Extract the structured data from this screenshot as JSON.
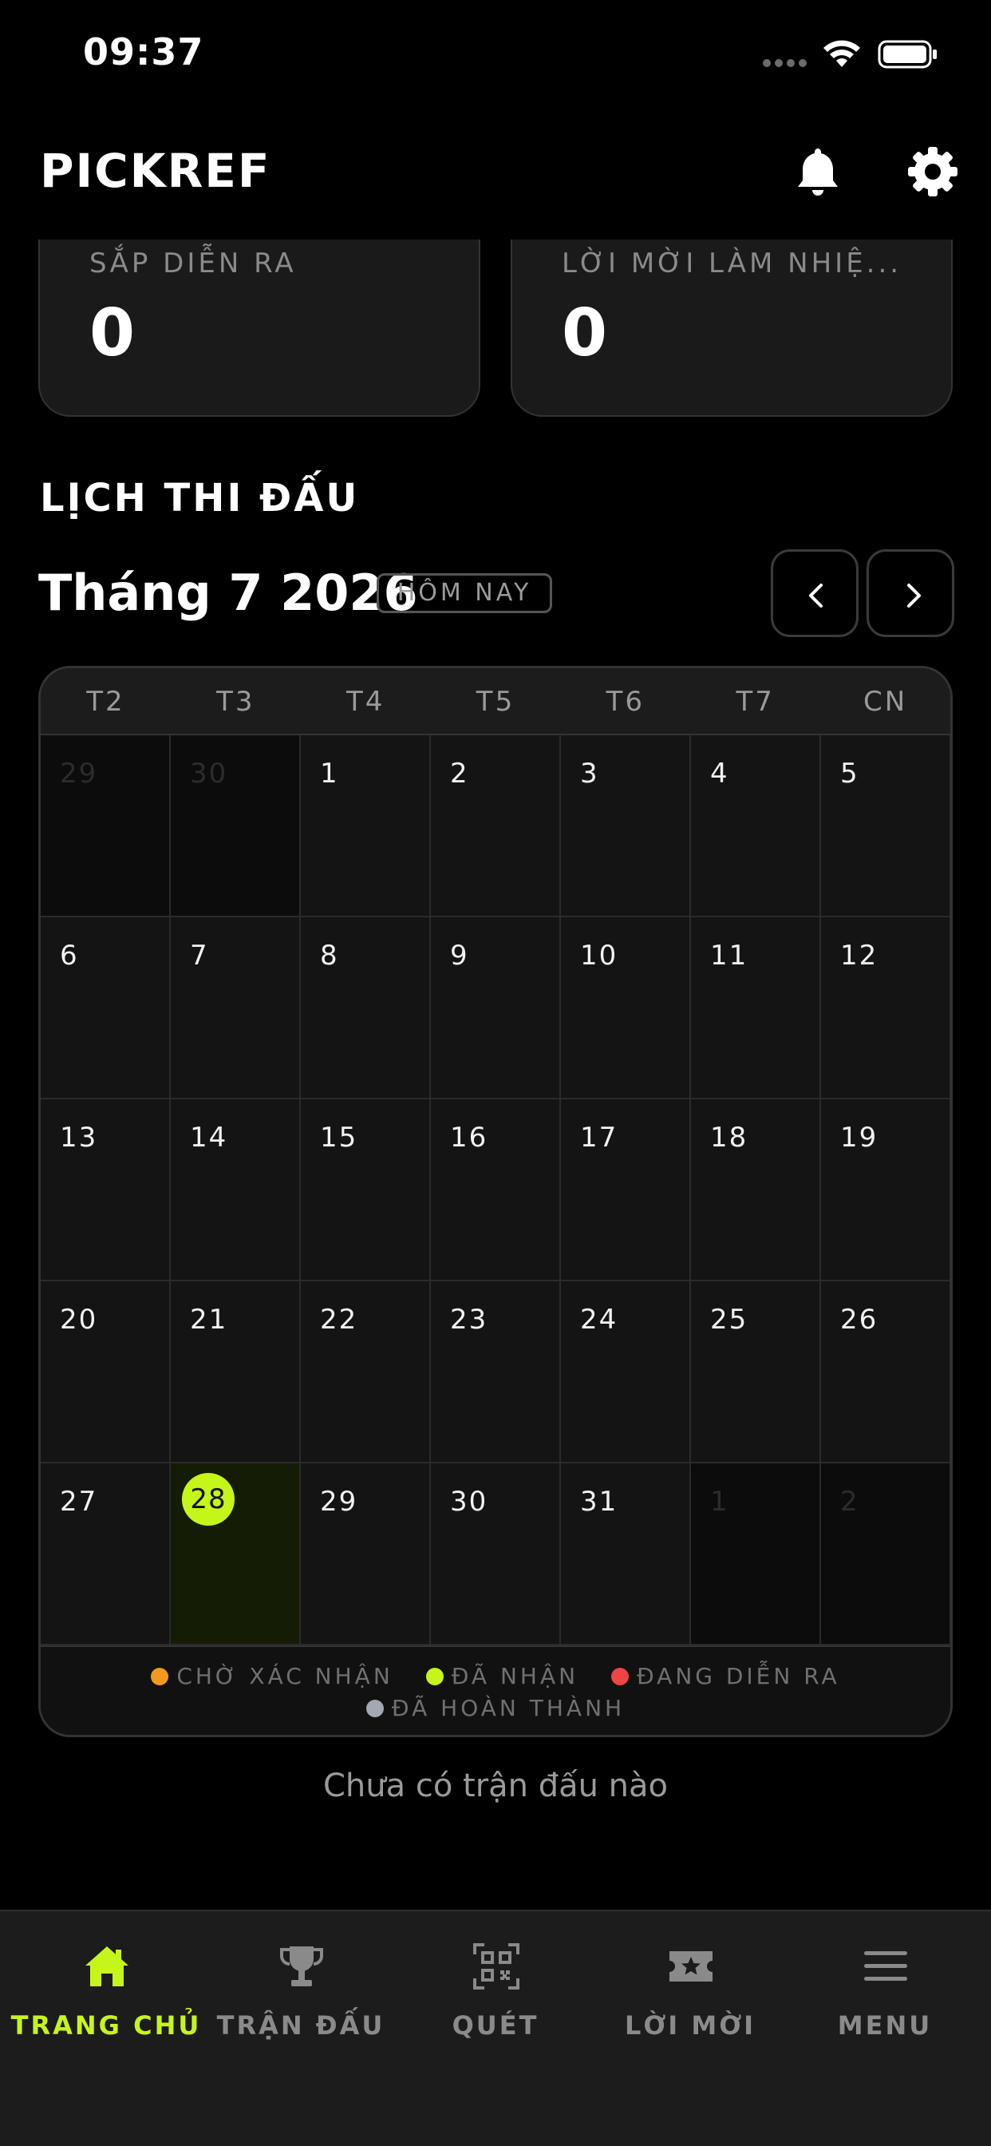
{
  "status_bar": {
    "time": "09:37"
  },
  "header": {
    "brand": "PICKREF"
  },
  "stats": [
    {
      "label": "SẮP DIỄN RA",
      "value": "0"
    },
    {
      "label": "LỜI MỜI LÀM NHIỆ...",
      "value": "0"
    }
  ],
  "schedule": {
    "section_title": "LỊCH THI ĐẤU",
    "month_title": "Tháng 7 2026",
    "today_label": "HÔM NAY",
    "weekdays": [
      "T2",
      "T3",
      "T4",
      "T5",
      "T6",
      "T7",
      "CN"
    ],
    "days": [
      "29",
      "30",
      "1",
      "2",
      "3",
      "4",
      "5",
      "6",
      "7",
      "8",
      "9",
      "10",
      "11",
      "12",
      "13",
      "14",
      "15",
      "16",
      "17",
      "18",
      "19",
      "20",
      "21",
      "22",
      "23",
      "24",
      "25",
      "26",
      "27",
      "28",
      "29",
      "30",
      "31",
      "1",
      "2"
    ],
    "outside_month_indices": [
      0,
      1,
      33,
      34
    ],
    "today_index": 29,
    "legend": [
      {
        "label": "CHỜ XÁC NHẬN",
        "color": "#f39a1c"
      },
      {
        "label": "ĐÃ NHẬN",
        "color": "#c6f51a"
      },
      {
        "label": "ĐANG DIỄN RA",
        "color": "#ef4444"
      },
      {
        "label": "ĐÃ HOÀN THÀNH",
        "color": "#a3a8b3"
      }
    ],
    "empty_text": "Chưa có trận đấu nào"
  },
  "bottom_nav": [
    {
      "label": "TRANG CHỦ",
      "icon": "home-icon",
      "active": true
    },
    {
      "label": "TRẬN ĐẤU",
      "icon": "trophy-icon",
      "active": false
    },
    {
      "label": "QUÉT",
      "icon": "qr-scan-icon",
      "active": false
    },
    {
      "label": "LỜI MỜI",
      "icon": "ticket-star-icon",
      "active": false
    },
    {
      "label": "MENU",
      "icon": "menu-icon",
      "active": false
    }
  ],
  "colors": {
    "accent": "#c6f51a",
    "background": "#000000",
    "card": "#1a1a1a"
  }
}
